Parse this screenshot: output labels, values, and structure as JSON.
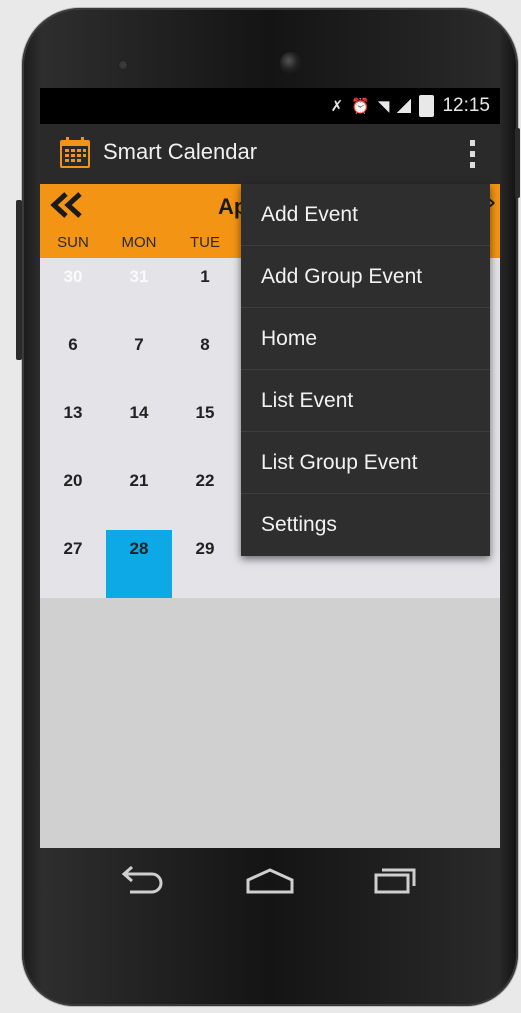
{
  "status_bar": {
    "time": "12:15",
    "icons": [
      "mute-icon",
      "alarm-icon",
      "wifi-icon",
      "signal-icon",
      "battery-icon"
    ]
  },
  "action_bar": {
    "app_icon": "calendar-icon",
    "title": "Smart Calendar",
    "overflow_icon": "overflow-menu-icon"
  },
  "calendar": {
    "prev_icon": "double-chevron-left-icon",
    "month_label_visible": "Ap",
    "next_icon": "chevron-right-icon",
    "weekdays": [
      "SUN",
      "MON",
      "TUE"
    ],
    "weeks": [
      [
        "30",
        "31",
        "1"
      ],
      [
        "6",
        "7",
        "8"
      ],
      [
        "13",
        "14",
        "15"
      ],
      [
        "20",
        "21",
        "22"
      ],
      [
        "27",
        "28",
        "29"
      ]
    ],
    "selected_day": "28"
  },
  "overflow_menu": {
    "items": [
      "Add Event",
      "Add Group Event",
      "Home",
      "List Event",
      "List Group Event",
      "Settings"
    ]
  },
  "nav_bar": {
    "buttons": [
      "back-icon",
      "home-icon",
      "recent-apps-icon"
    ]
  },
  "colors": {
    "accent": "#f39414",
    "today": "#0ca9e6",
    "action_bar": "#2a2a2a",
    "menu_bg": "#2e2e2e"
  }
}
